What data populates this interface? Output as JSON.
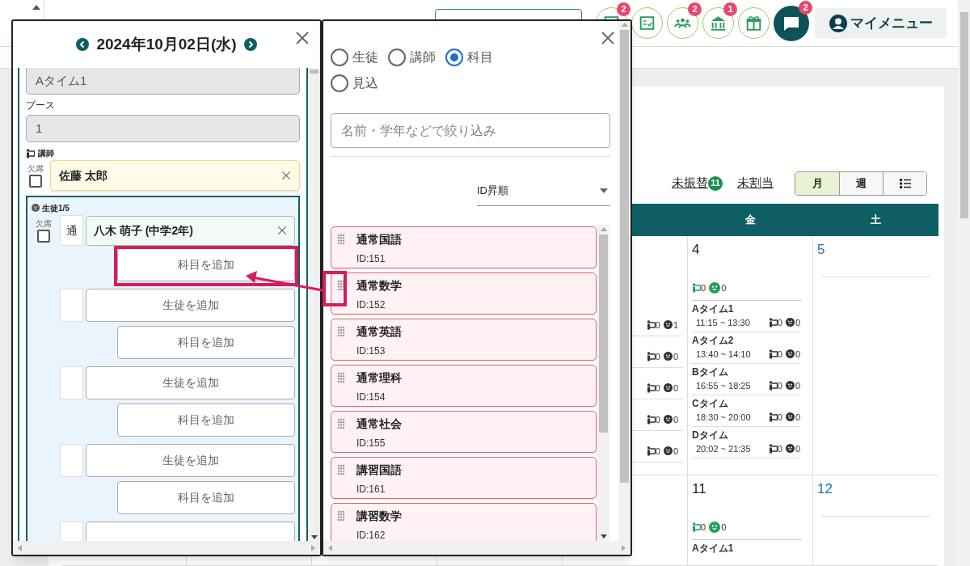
{
  "header": {
    "icon_buttons": [
      {
        "badge": "2",
        "selected": false
      },
      {
        "selected": false
      },
      {
        "badge": "2",
        "selected": false
      },
      {
        "badge": "1",
        "selected": false
      },
      {
        "selected": false
      },
      {
        "badge": "2",
        "selected": true
      }
    ],
    "my_menu": "マイメニュー"
  },
  "calendar": {
    "links": [
      {
        "label": "未振替",
        "count": "11"
      },
      {
        "label": "未割当"
      }
    ],
    "views": [
      {
        "kind": "text",
        "label": "月",
        "selected": true
      },
      {
        "kind": "text",
        "label": "週",
        "selected": false
      },
      {
        "kind": "list",
        "selected": false
      }
    ],
    "weekdays": [
      "金",
      "土"
    ],
    "weeks": [
      {
        "thursday_slots": [
          {
            "teacher": "0",
            "student": "1"
          },
          {
            "teacher": "0",
            "student": "0"
          },
          {
            "teacher": "0",
            "student": "0"
          },
          {
            "teacher": "0",
            "student": "0"
          },
          {
            "teacher": "0",
            "student": "0"
          }
        ],
        "days": [
          {
            "date": "4",
            "color": "#222222",
            "teacher_total": "0",
            "student_total": "0",
            "slots": [
              {
                "name": "Aタイム1",
                "time": "11:15 ~ 13:30",
                "teacher": "0",
                "student": "0"
              },
              {
                "name": "Aタイム2",
                "time": "13:40 ~ 14:10",
                "teacher": "0",
                "student": "0"
              },
              {
                "name": "Bタイム",
                "time": "16:55 ~ 18:25",
                "teacher": "0",
                "student": "0"
              },
              {
                "name": "Cタイム",
                "time": "18:30 ~ 20:00",
                "teacher": "0",
                "student": "0"
              },
              {
                "name": "Dタイム",
                "time": "20:02 ~ 21:35",
                "teacher": "0",
                "student": "0"
              }
            ]
          },
          {
            "date": "5",
            "color": "#1e6fb8"
          }
        ]
      },
      {
        "days": [
          {
            "date": "11",
            "color": "#222222",
            "teacher_total": "0",
            "student_total": "0",
            "slots": [
              {
                "name": "Aタイム1"
              }
            ]
          },
          {
            "date": "12",
            "color": "#1e6fb8"
          }
        ]
      }
    ]
  },
  "lesson": {
    "date": "2024年10月02日(水)",
    "time_slot": "Aタイム1",
    "booth_label": "ブース",
    "booth": "1",
    "teacher_label": "講師",
    "teacher": {
      "absent_label": "欠席",
      "absent": false,
      "name": "佐藤 太郎"
    },
    "students_label": "生徒1/5",
    "students": [
      {
        "absent_label": "欠席",
        "absent": false,
        "type": "通",
        "name": "八木 萌子 (中学2年)",
        "add_subject": "科目を追加",
        "highlighted": true
      }
    ],
    "empty_slots": [
      {
        "add_student": "生徒を追加",
        "add_subject": "科目を追加"
      },
      {
        "add_student": "生徒を追加",
        "add_subject": "科目を追加"
      },
      {
        "add_student": "生徒を追加",
        "add_subject": "科目を追加"
      }
    ]
  },
  "filter": {
    "options": [
      {
        "label": "生徒",
        "selected": false
      },
      {
        "label": "講師",
        "selected": false
      },
      {
        "label": "科目",
        "selected": true
      },
      {
        "label": "見込",
        "selected": false
      }
    ],
    "search": {
      "placeholder": "名前・学年などで絞り込み"
    },
    "sort": "ID昇順"
  },
  "subjects": {
    "items": [
      {
        "name": "通常国語",
        "id": "ID:151",
        "highlighted": false
      },
      {
        "name": "通常数学",
        "id": "ID:152",
        "highlighted": true
      },
      {
        "name": "通常英語",
        "id": "ID:153",
        "highlighted": false
      },
      {
        "name": "通常理科",
        "id": "ID:154",
        "highlighted": false
      },
      {
        "name": "通常社会",
        "id": "ID:155",
        "highlighted": false
      },
      {
        "name": "講習国語",
        "id": "ID:161",
        "highlighted": false
      },
      {
        "name": "講習数学",
        "id": "ID:162",
        "highlighted": false
      }
    ]
  }
}
